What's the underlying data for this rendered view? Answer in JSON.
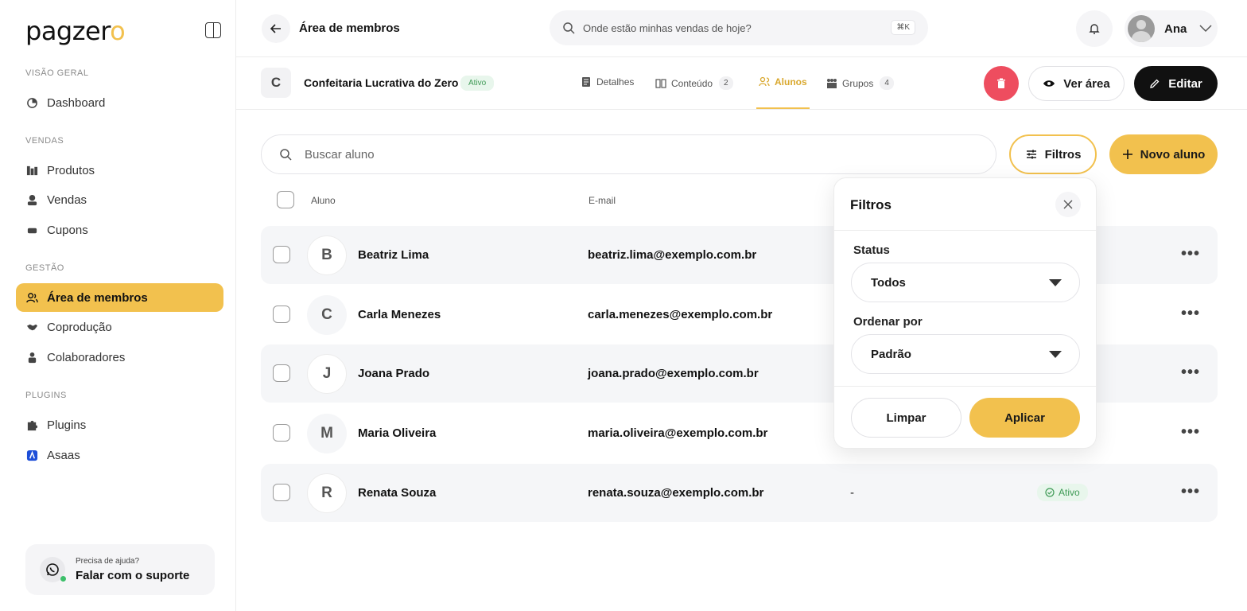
{
  "brand": {
    "logo_text": "pagzer",
    "logo_accent": "o",
    "accent_color": "#f2c14e"
  },
  "sidebar": {
    "sections": [
      {
        "label": "VISÃO GERAL"
      },
      {
        "label": "VENDAS"
      },
      {
        "label": "GESTÃO"
      },
      {
        "label": "PLUGINS"
      }
    ],
    "items": [
      {
        "label": "Dashboard",
        "icon": "dashboard-icon"
      },
      {
        "label": "Produtos",
        "icon": "products-icon"
      },
      {
        "label": "Vendas",
        "icon": "sales-icon"
      },
      {
        "label": "Cupons",
        "icon": "coupon-icon"
      },
      {
        "label": "Área de membros",
        "icon": "members-icon",
        "active": true
      },
      {
        "label": "Coprodução",
        "icon": "handshake-icon"
      },
      {
        "label": "Colaboradores",
        "icon": "collaborators-icon"
      },
      {
        "label": "Plugins",
        "icon": "puzzle-icon"
      },
      {
        "label": "Asaas",
        "icon": "asaas-icon"
      }
    ],
    "support": {
      "small": "Precisa de ajuda?",
      "big": "Falar com o suporte"
    }
  },
  "topbar": {
    "title": "Área de membros",
    "search_placeholder": "Onde estão minhas vendas de hoje?",
    "shortcut": "⌘K",
    "user_name": "Ana"
  },
  "course": {
    "initial": "C",
    "name": "Confeitaria Lucrativa do Zero",
    "status": "Ativo",
    "tabs": [
      {
        "label": "Detalhes",
        "count": ""
      },
      {
        "label": "Conteúdo",
        "count": "2"
      },
      {
        "label": "Alunos",
        "count": "",
        "active": true
      },
      {
        "label": "Grupos",
        "count": "4"
      }
    ],
    "ver_area": "Ver área",
    "editar": "Editar"
  },
  "students": {
    "search_placeholder": "Buscar aluno",
    "filters_label": "Filtros",
    "new_label": "Novo aluno",
    "columns": {
      "name": "Aluno",
      "email": "E-mail"
    },
    "rows": [
      {
        "initial": "B",
        "name": "Beatriz Lima",
        "email": "beatriz.lima@exemplo.com.br",
        "extra": "",
        "status": ""
      },
      {
        "initial": "C",
        "name": "Carla Menezes",
        "email": "carla.menezes@exemplo.com.br",
        "extra": "",
        "status": ""
      },
      {
        "initial": "J",
        "name": "Joana Prado",
        "email": "joana.prado@exemplo.com.br",
        "extra": "",
        "status": ""
      },
      {
        "initial": "M",
        "name": "Maria Oliveira",
        "email": "maria.oliveira@exemplo.com.br",
        "extra": "",
        "status": ""
      },
      {
        "initial": "R",
        "name": "Renata Souza",
        "email": "renata.souza@exemplo.com.br",
        "extra": "-",
        "status": "Ativo"
      }
    ]
  },
  "filter_popup": {
    "title": "Filtros",
    "status_label": "Status",
    "status_value": "Todos",
    "order_label": "Ordenar por",
    "order_value": "Padrão",
    "clear": "Limpar",
    "apply": "Aplicar"
  }
}
